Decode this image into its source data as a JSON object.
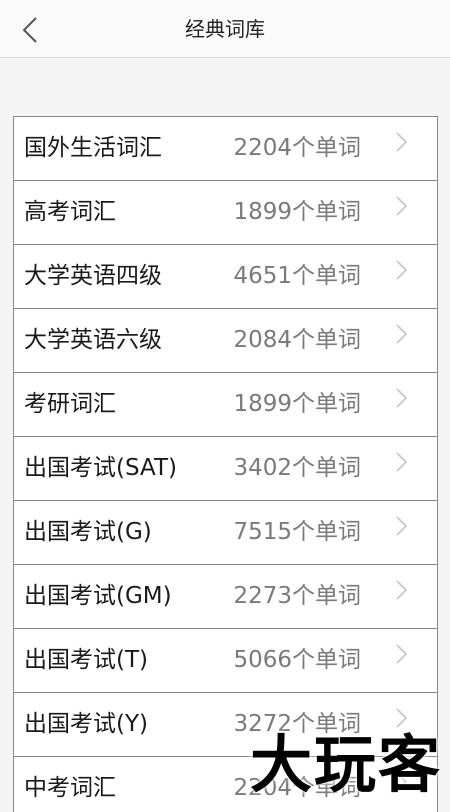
{
  "header": {
    "title": "经典词库",
    "back_icon": "chevron-left-icon"
  },
  "wordbanks": [
    {
      "name": "国外生活词汇",
      "count": "2204个单词"
    },
    {
      "name": "高考词汇",
      "count": "1899个单词"
    },
    {
      "name": "大学英语四级",
      "count": "4651个单词"
    },
    {
      "name": "大学英语六级",
      "count": "2084个单词"
    },
    {
      "name": "考研词汇",
      "count": "1899个单词"
    },
    {
      "name": "出国考试(SAT)",
      "count": "3402个单词"
    },
    {
      "name": "出国考试(G)",
      "count": "7515个单词"
    },
    {
      "name": "出国考试(GM)",
      "count": "2273个单词"
    },
    {
      "name": "出国考试(T)",
      "count": "5066个单词"
    },
    {
      "name": "出国考试(Y)",
      "count": "3272个单词"
    },
    {
      "name": "中考词汇",
      "count": "2204个单词"
    }
  ],
  "row_icon": "chevron-right-icon",
  "watermark": "大玩客"
}
